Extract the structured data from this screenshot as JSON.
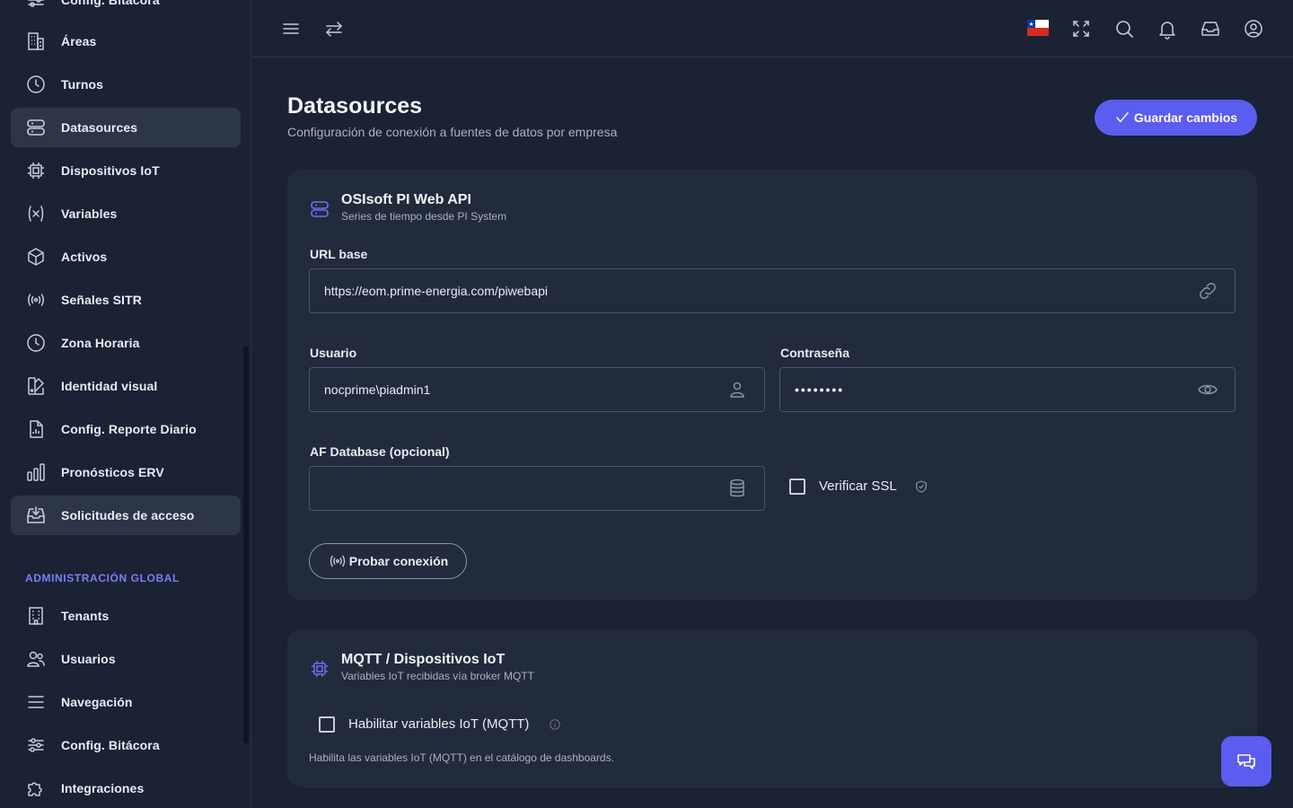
{
  "sidebar": {
    "top_partial": "Config. Bitácora",
    "items": [
      {
        "label": "Áreas"
      },
      {
        "label": "Turnos"
      },
      {
        "label": "Datasources"
      },
      {
        "label": "Dispositivos IoT"
      },
      {
        "label": "Variables"
      },
      {
        "label": "Activos"
      },
      {
        "label": "Señales SITR"
      },
      {
        "label": "Zona Horaria"
      },
      {
        "label": "Identidad visual"
      },
      {
        "label": "Config. Reporte Diario"
      },
      {
        "label": "Pronósticos ERV"
      },
      {
        "label": "Solicitudes de acceso"
      }
    ],
    "global_section_title": "ADMINISTRACIÓN GLOBAL",
    "global_items": [
      {
        "label": "Tenants"
      },
      {
        "label": "Usuarios"
      },
      {
        "label": "Navegación"
      },
      {
        "label": "Config. Bitácora"
      },
      {
        "label": "Integraciones"
      }
    ]
  },
  "page": {
    "title": "Datasources",
    "subtitle": "Configuración de conexión a fuentes de datos por empresa",
    "save_label": "Guardar cambios"
  },
  "osisoft": {
    "title": "OSIsoft PI Web API",
    "subtitle": "Series de tiempo desde PI System",
    "url_label": "URL base",
    "url_value": "https://eom.prime-energia.com/piwebapi",
    "user_label": "Usuario",
    "user_value": "nocprime\\piadmin1",
    "password_label": "Contraseña",
    "password_value": "••••••••",
    "af_label": "AF Database (opcional)",
    "af_value": "",
    "ssl_label": "Verificar SSL",
    "test_label": "Probar conexión"
  },
  "mqtt": {
    "title": "MQTT / Dispositivos IoT",
    "subtitle": "Variables IoT recibidas vía broker MQTT",
    "enable_label": "Habilitar variables IoT (MQTT)",
    "helper": "Habilita las variables IoT (MQTT) en el catálogo de dashboards."
  },
  "colors": {
    "accent": "#5b5cf0",
    "background": "#1a2233",
    "card": "#222b3b",
    "active_nav": "#2d3647",
    "section_title": "#7b7ff6"
  }
}
